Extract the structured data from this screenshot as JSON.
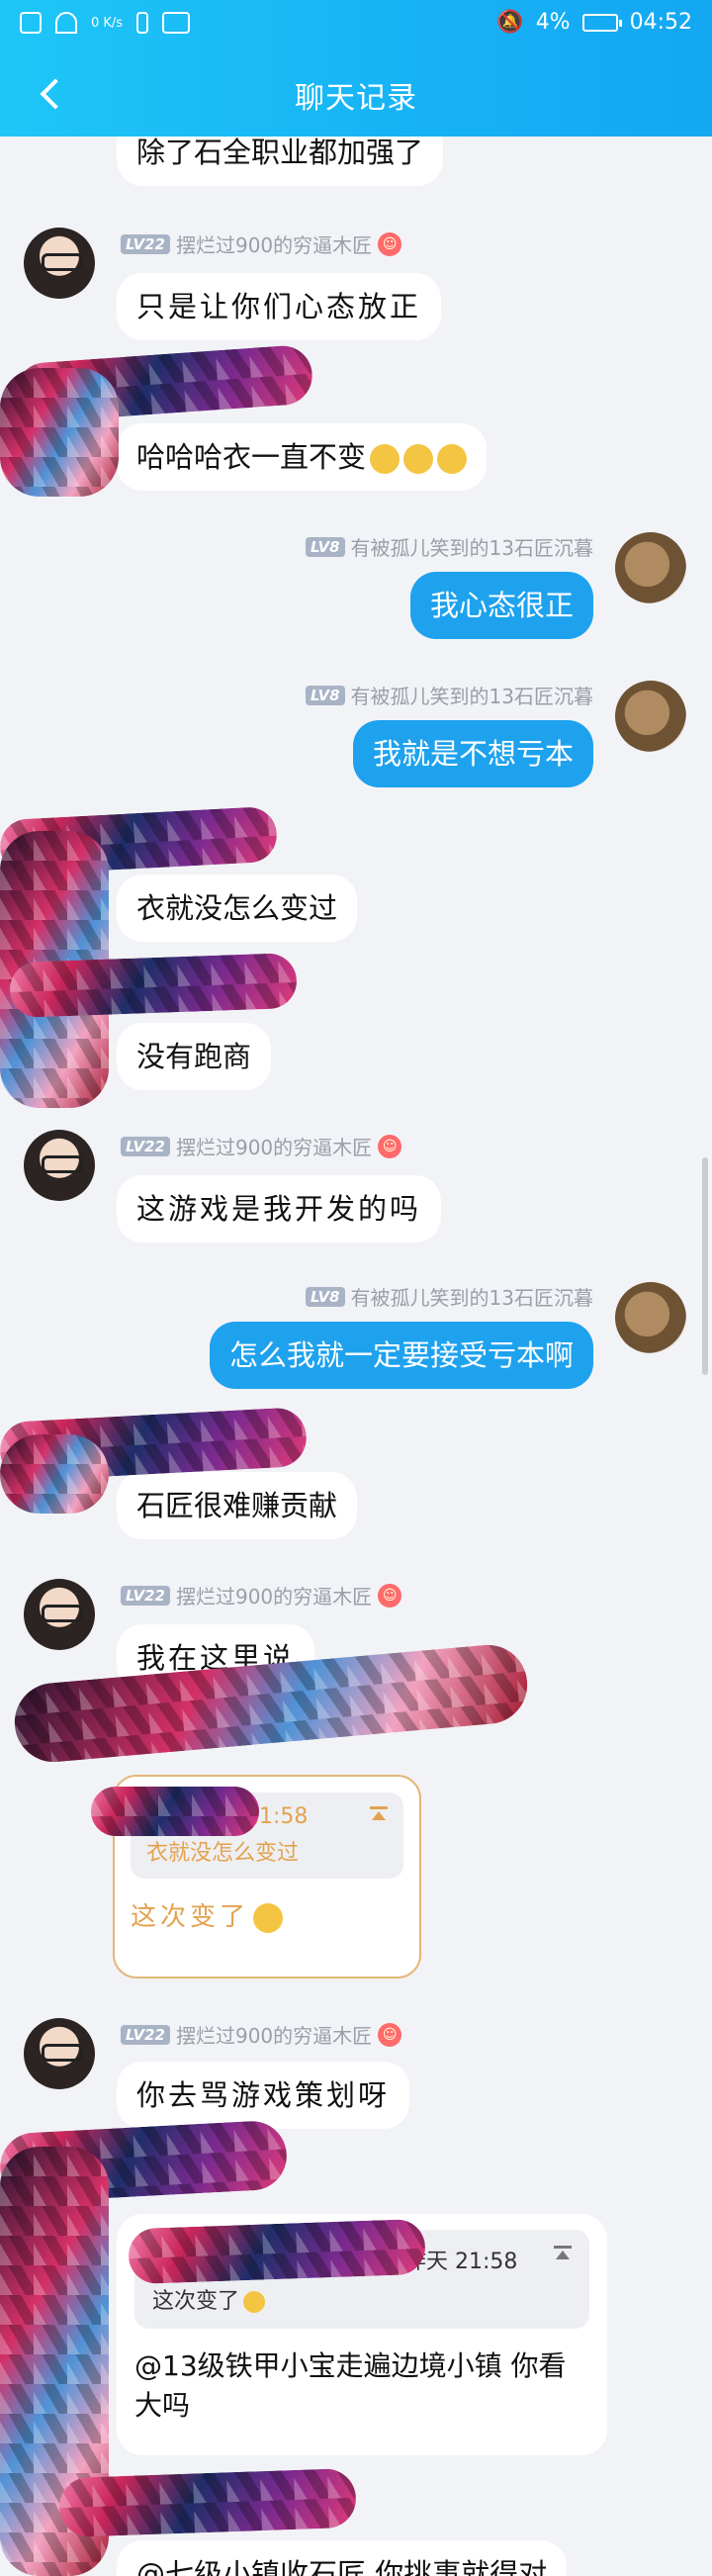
{
  "status_bar": {
    "speed": "0 K/s",
    "battery": "4%",
    "time": "04:52"
  },
  "header": {
    "title": "聊天记录"
  },
  "users": {
    "girl": {
      "level": "LV22",
      "name": "摆烂过900的穷逼木匠"
    },
    "me": {
      "level": "LV8",
      "name": "有被孤儿笑到的13石匠沉暮"
    }
  },
  "messages": [
    {
      "text": "除了石全职业都加强了"
    },
    {
      "text": "只是让你们心态放正"
    },
    {
      "text": "哈哈哈衣一直不变"
    },
    {
      "text": "我心态很正"
    },
    {
      "text": "我就是不想亏本"
    },
    {
      "text": "衣就没怎么变过"
    },
    {
      "text": "没有跑商"
    },
    {
      "text": "这游戏是我开发的吗"
    },
    {
      "text": "怎么我就一定要接受亏本啊"
    },
    {
      "text": "石匠很难赚贡献"
    },
    {
      "text": "我在这里说"
    },
    {
      "text": "你去骂游戏策划呀"
    },
    {
      "text": "@七级小镇收石匠 你挑事就得对"
    }
  ],
  "quote1": {
    "time": "21:58",
    "text": "衣就没怎么变过",
    "reply": "这次变了"
  },
  "quote2": {
    "time": "昨天 21:58",
    "text": "这次变了",
    "reply": "@13级铁甲小宝走遍边境小镇 你看大吗"
  },
  "colors": {
    "header": "#16b2f5",
    "my_bubble": "#1ea2ee",
    "background": "#f2f3f7",
    "quote_accent": "#e3a24e"
  }
}
